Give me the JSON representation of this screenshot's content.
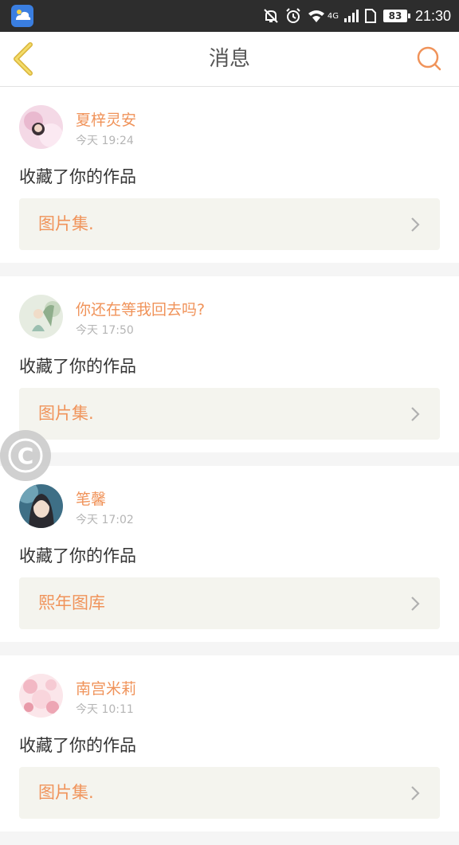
{
  "status_bar": {
    "network_label": "4G",
    "battery": "83",
    "time": "21:30",
    "icons": [
      "app-icon",
      "mute-bell-icon",
      "alarm-icon",
      "wifi-icon",
      "signal-icon",
      "sim-icon",
      "battery-icon"
    ]
  },
  "header": {
    "title": "消息",
    "back_icon": "chevron-left-icon",
    "search_icon": "search-icon"
  },
  "colors": {
    "accent": "#f0935a",
    "back_icon": "#e8c43a",
    "status_bar": "#2d2d2d",
    "work_box": "#f4f4ee"
  },
  "messages": [
    {
      "user": "夏梓灵安",
      "time": "今天 19:24",
      "action": "收藏了你的作品",
      "work": "图片集."
    },
    {
      "user": "你还在等我回去吗?",
      "time": "今天 17:50",
      "action": "收藏了你的作品",
      "work": "图片集."
    },
    {
      "user": "笔馨",
      "time": "今天 17:02",
      "action": "收藏了你的作品",
      "work": "熙年图库"
    },
    {
      "user": "南宫米莉",
      "time": "今天 10:11",
      "action": "收藏了你的作品",
      "work": "图片集."
    }
  ],
  "floating_button": {
    "label": "C"
  }
}
